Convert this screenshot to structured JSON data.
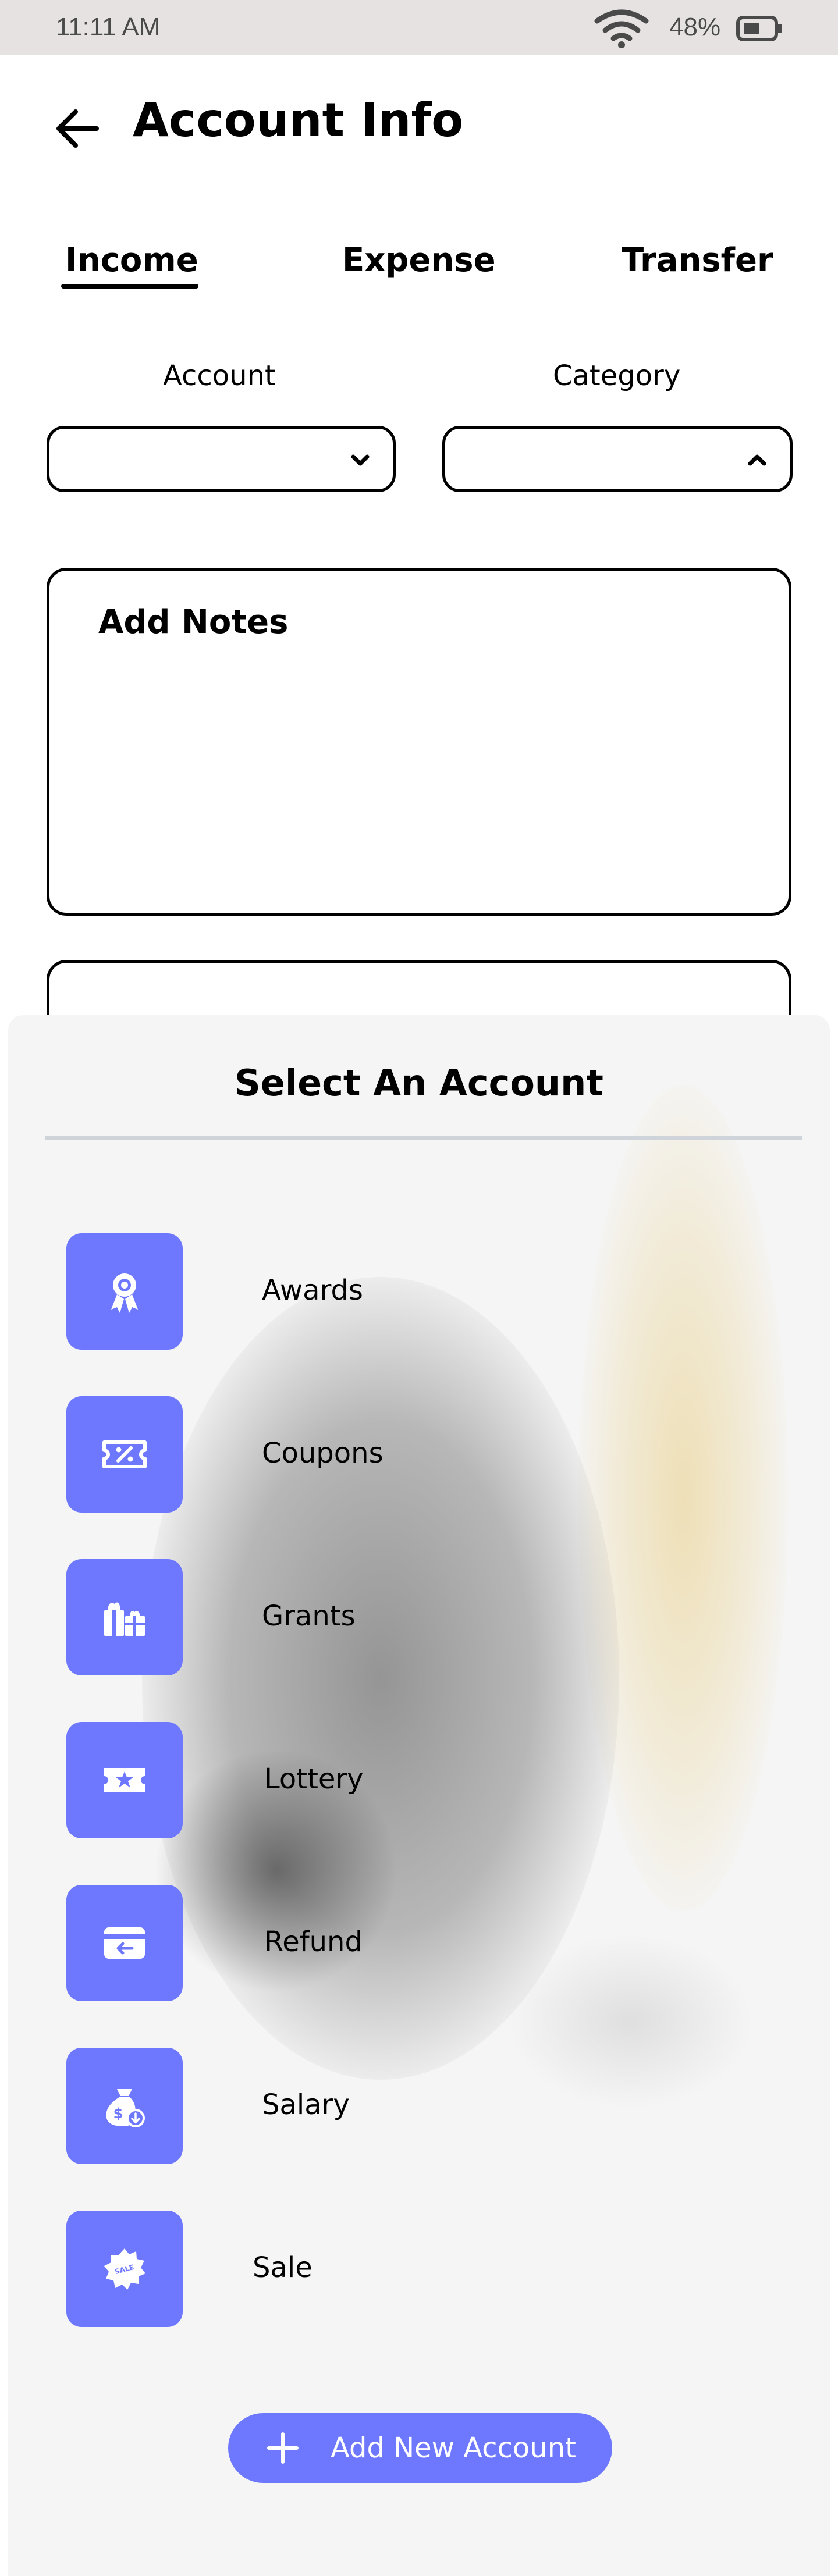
{
  "status_bar": {
    "time": "11:11 AM",
    "battery": "48%"
  },
  "header": {
    "title": "Account Info"
  },
  "tabs": [
    {
      "label": "Income",
      "active": true
    },
    {
      "label": "Expense",
      "active": false
    },
    {
      "label": "Transfer",
      "active": false
    }
  ],
  "fields": {
    "account_label": "Account",
    "category_label": "Category",
    "account_value": "",
    "category_value": ""
  },
  "notes": {
    "label": "Add Notes"
  },
  "sheet": {
    "title": "Select An Account",
    "items": [
      {
        "label": "Awards",
        "icon": "award-ribbon-icon"
      },
      {
        "label": "Coupons",
        "icon": "coupon-icon"
      },
      {
        "label": "Grants",
        "icon": "gift-icon"
      },
      {
        "label": "Lottery",
        "icon": "ticket-star-icon"
      },
      {
        "label": "Refund",
        "icon": "card-refund-icon"
      },
      {
        "label": "Salary",
        "icon": "money-bag-icon"
      },
      {
        "label": "Sale",
        "icon": "sale-badge-icon"
      }
    ],
    "add_button": "Add New Account"
  },
  "colors": {
    "accent": "#6e78ff",
    "sheet_bg": "#f5f5f5",
    "status_bar": "#e6e2e2"
  }
}
